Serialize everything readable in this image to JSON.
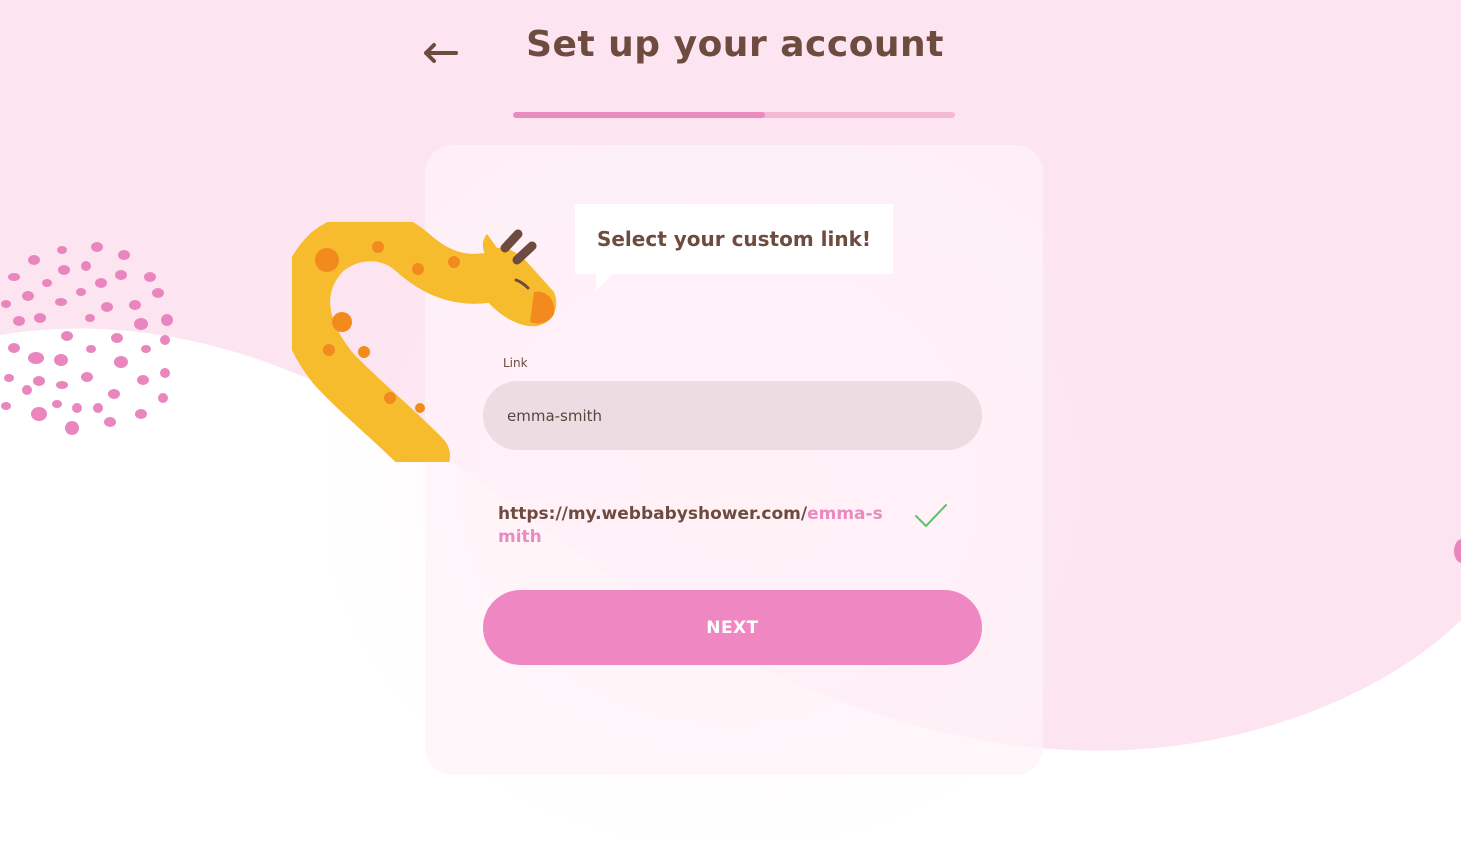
{
  "header": {
    "title": "Set up your account",
    "back_icon": "arrow-left-icon",
    "progress_fraction": 0.57
  },
  "bubble": {
    "text": "Select your custom link!"
  },
  "form": {
    "link_label": "Link",
    "link_value": "emma-smith",
    "url_base": "https://my.webbabyshower.com/",
    "url_slug": "emma-smith",
    "valid_icon": "checkmark-icon",
    "next_label": "NEXT"
  },
  "colors": {
    "background": "#fce4f0",
    "brown": "#6e4b3f",
    "pink": "#ef88c2",
    "input_bg": "#ecdde2",
    "check_green": "#5cc46a"
  }
}
